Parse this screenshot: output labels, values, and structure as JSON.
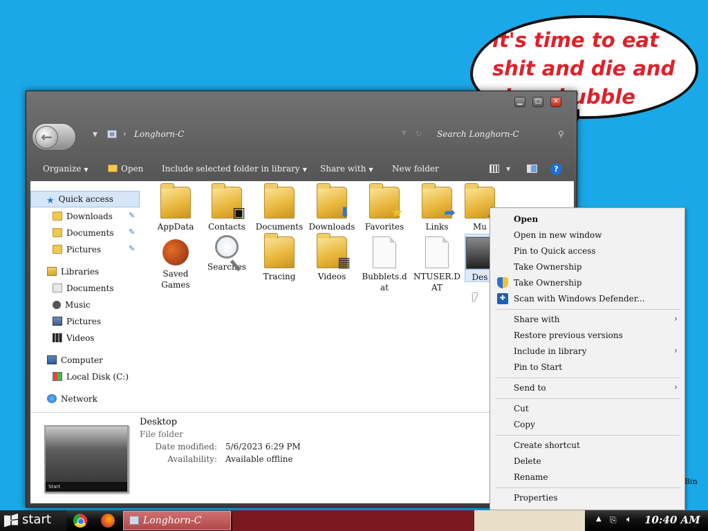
{
  "bubble": {
    "text": "it's time to eat shit and die and chew bubble gum"
  },
  "window": {
    "address": "Longhorn-C",
    "search_placeholder": "Search Longhorn-C",
    "toolbar": {
      "organize": "Organize",
      "open": "Open",
      "include": "Include selected folder in library",
      "share": "Share with",
      "new_folder": "New folder"
    }
  },
  "nav": {
    "quick_access": "Quick access",
    "downloads": "Downloads",
    "documents": "Documents",
    "pictures": "Pictures",
    "libraries": "Libraries",
    "lib_documents": "Documents",
    "lib_music": "Music",
    "lib_pictures": "Pictures",
    "lib_videos": "Videos",
    "computer": "Computer",
    "local_disk": "Local Disk (C:)",
    "network": "Network"
  },
  "files": [
    {
      "name": "AppData"
    },
    {
      "name": "Contacts"
    },
    {
      "name": "Documents"
    },
    {
      "name": "Downloads"
    },
    {
      "name": "Favorites"
    },
    {
      "name": "Links"
    },
    {
      "name": "Mu"
    },
    {
      "name": "Saved Games"
    },
    {
      "name": "Searches"
    },
    {
      "name": "Tracing"
    },
    {
      "name": "Videos"
    },
    {
      "name": "Bubblets.dat"
    },
    {
      "name": "NTUSER.DAT"
    },
    {
      "name": "Des"
    }
  ],
  "details": {
    "name": "Desktop",
    "type": "File folder",
    "date_label": "Date modified:",
    "date_value": "5/6/2023 6:29 PM",
    "avail_label": "Availability:",
    "avail_value": "Available offline",
    "thumb_bar": "Start"
  },
  "menu": {
    "open": "Open",
    "open_new_window": "Open in new window",
    "pin_quick": "Pin to Quick access",
    "take_ownership_1": "Take Ownership",
    "take_ownership_2": "Take Ownership",
    "scan": "Scan with Windows Defender...",
    "share": "Share with",
    "restore": "Restore previous versions",
    "include": "Include in library",
    "pin_start": "Pin to Start",
    "send_to": "Send to",
    "cut": "Cut",
    "copy": "Copy",
    "shortcut": "Create shortcut",
    "delete": "Delete",
    "rename": "Rename",
    "properties": "Properties"
  },
  "taskbar": {
    "start": "start",
    "explorer": "Longhorn-C",
    "clock": "10:40 AM"
  },
  "desktop": {
    "bin": "Bin"
  }
}
